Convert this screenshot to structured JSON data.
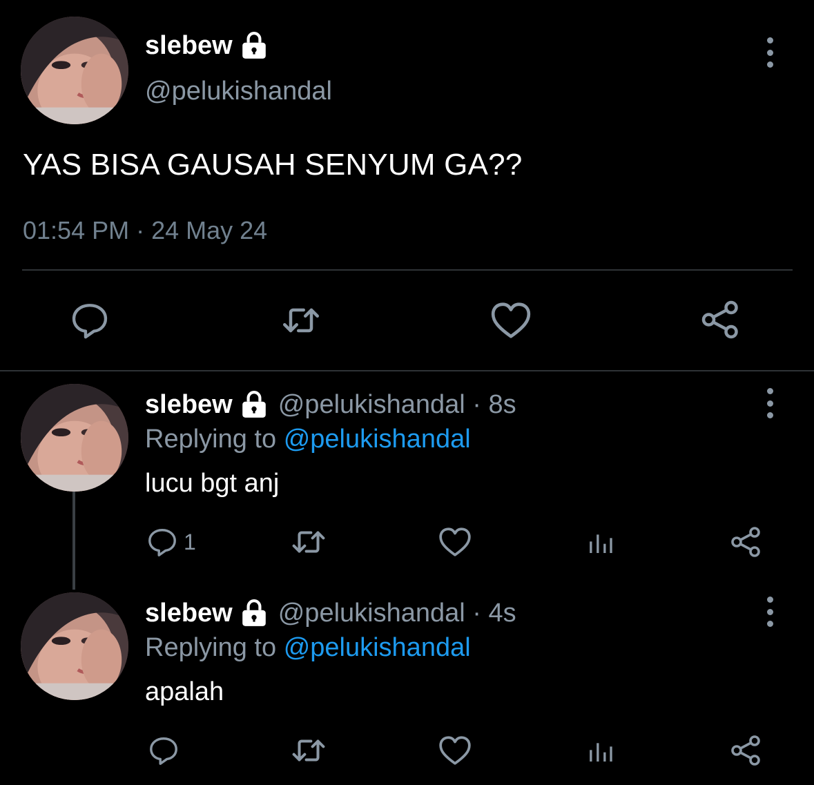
{
  "main_tweet": {
    "display_name": "slebew",
    "handle": "@pelukishandal",
    "text": "YAS BISA GAUSAH SENYUM GA??",
    "timestamp": "01:54 PM · 24 May 24",
    "actions": [
      "reply-icon",
      "retweet-icon",
      "like-icon",
      "share-icon"
    ],
    "menu_icon": "more-vertical-icon"
  },
  "replies": [
    {
      "display_name": "slebew",
      "handle_time": "@pelukishandal · 8s",
      "replying_prefix": "Replying to",
      "replying_to": "@pelukishandal",
      "text": "lucu bgt anj",
      "reply_count": "1",
      "actions": [
        "reply-icon",
        "retweet-icon",
        "like-icon",
        "analytics-icon",
        "share-icon"
      ]
    },
    {
      "display_name": "slebew",
      "handle_time": "@pelukishandal · 4s",
      "replying_prefix": "Replying to",
      "replying_to": "@pelukishandal",
      "text": "apalah",
      "reply_count": "",
      "actions": [
        "reply-icon",
        "retweet-icon",
        "like-icon",
        "analytics-icon",
        "share-icon"
      ]
    }
  ],
  "colors": {
    "background": "#000000",
    "primary_text": "#ffffff",
    "secondary_text": "#8b98a5",
    "link": "#1d9bf0",
    "divider": "#2f3336"
  }
}
